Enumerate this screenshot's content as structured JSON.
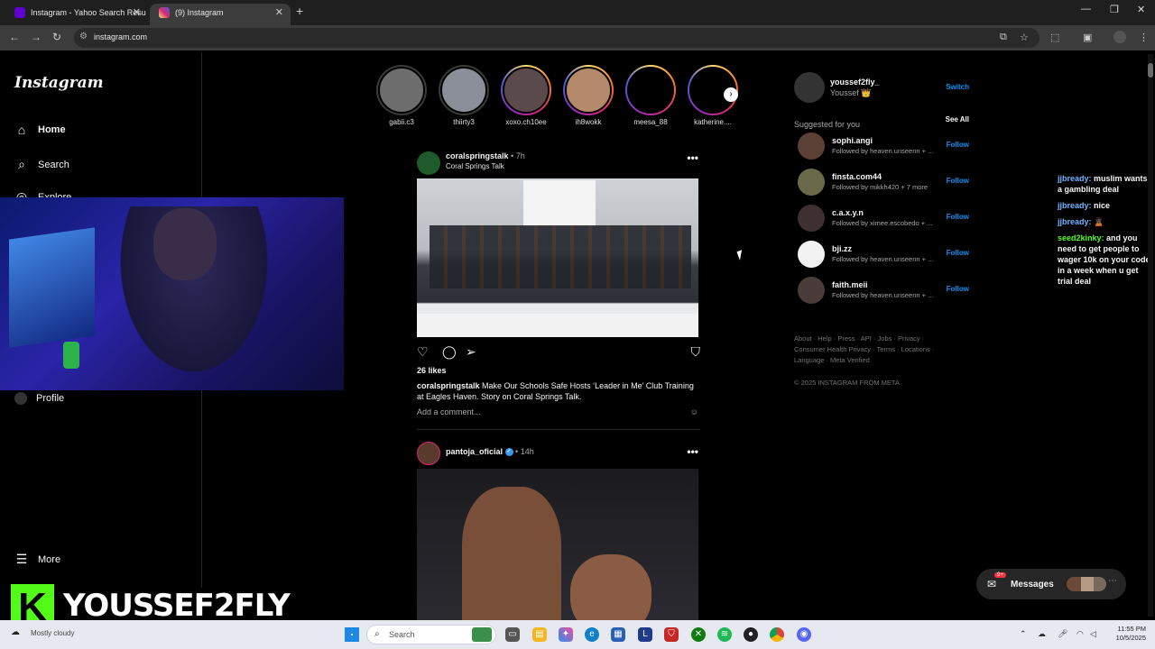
{
  "browser": {
    "tabs": [
      {
        "title": "Instagram - Yahoo Search Resu",
        "active": false
      },
      {
        "title": "(9) Instagram",
        "active": true
      }
    ],
    "url": "instagram.com"
  },
  "instagram": {
    "logo": "Instagram",
    "nav": {
      "home": "Home",
      "search": "Search",
      "explore": "Explore",
      "profile": "Profile",
      "more": "More"
    },
    "stories": [
      {
        "name": "gabii.c3",
        "seen": true
      },
      {
        "name": "thiirty3",
        "seen": true
      },
      {
        "name": "xoxo.ch10ee",
        "seen": false
      },
      {
        "name": "ih8wokk",
        "seen": false
      },
      {
        "name": "meesa_88",
        "seen": false
      },
      {
        "name": "katherine....",
        "seen": false
      }
    ],
    "posts": [
      {
        "username": "coralspringstalk",
        "time": "7h",
        "location": "Coral Springs Talk",
        "likes": "26 likes",
        "caption_user": "coralspringstalk",
        "caption_text": "Make Our Schools Safe Hosts ‘Leader in Me’ Club Training at Eagles Haven. Story on Coral Springs Talk.",
        "add_comment": "Add a comment..."
      },
      {
        "username": "pantoja_oficial",
        "time": "14h",
        "verified": true
      }
    ],
    "sidebar": {
      "me_username": "youssef2fly_",
      "me_name": "Youssef 👑",
      "switch": "Switch",
      "suggested_title": "Suggested for you",
      "see_all": "See All",
      "follow": "Follow",
      "suggestions": [
        {
          "username": "sophi.angi",
          "sub": "Followed by heaven.unseenn + ..."
        },
        {
          "username": "finsta.com44",
          "sub": "Followed by mikkh420 + 7 more"
        },
        {
          "username": "c.a.x.y.n",
          "sub": "Followed by ximee.escobedo + ..."
        },
        {
          "username": "bji.zz",
          "sub": "Followed by heaven.unseenn + ..."
        },
        {
          "username": "faith.meii",
          "sub": "Followed by heaven.unseenn + ..."
        }
      ],
      "footer_line1": "About · Help · Press · API · Jobs · Privacy ·",
      "footer_line2": "Consumer Health Privacy · Terms · Locations ·",
      "footer_line3": "Language · Meta Verified",
      "copyright": "© 2025 INSTAGRAM FROM META"
    },
    "messages": {
      "label": "Messages",
      "badge": "9+"
    }
  },
  "stream": {
    "brand_name": "YOUSSEF2FLY",
    "chat": [
      {
        "user": "jjbready:",
        "text": "muslim wants a gambling deal"
      },
      {
        "user": "jjbready:",
        "text": "nice"
      },
      {
        "user": "jjbready:",
        "text": "🙎🏿"
      },
      {
        "user": "seed2kinky:",
        "text": "and you need to get people to wager 10k on your code in a week when u get trial deal"
      }
    ]
  },
  "taskbar": {
    "weather": "Mostly cloudy",
    "search_label": "Search",
    "time": "11:55 PM",
    "date": "10/5/2025"
  },
  "colors": {
    "accent": "#0095f6",
    "kick_green": "#53fc18",
    "background": "#000000"
  }
}
